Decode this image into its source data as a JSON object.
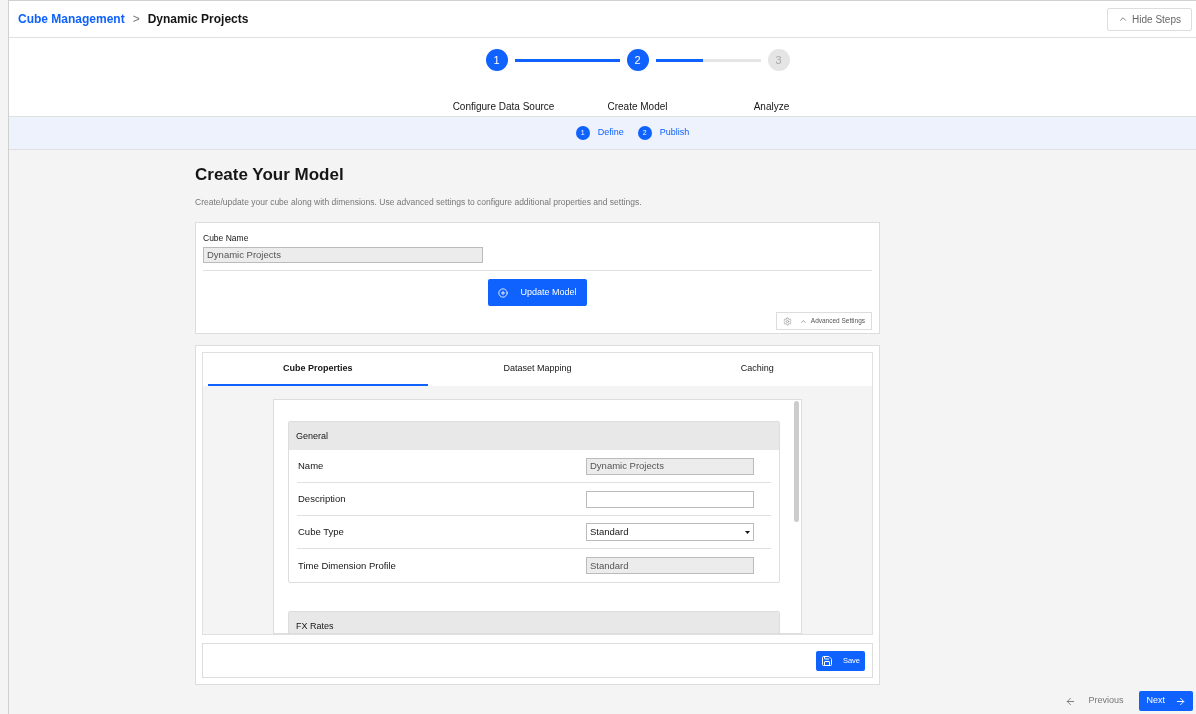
{
  "breadcrumb": {
    "parent": "Cube Management",
    "separator": ">",
    "current": "Dynamic Projects"
  },
  "hide_steps": {
    "label": "Hide Steps"
  },
  "steps": [
    {
      "number": "1",
      "label": "Configure Data Source",
      "reached": true
    },
    {
      "number": "2",
      "label": "Create Model",
      "reached": true
    },
    {
      "number": "3",
      "label": "Analyze",
      "reached": false
    }
  ],
  "connectors": [
    {
      "level": 1
    },
    {
      "level": 0.45
    }
  ],
  "substeps": [
    {
      "number": "1",
      "label": "Define"
    },
    {
      "number": "2",
      "label": "Publish"
    }
  ],
  "page": {
    "title": "Create Your Model",
    "subtitle": "Create/update your cube along with dimensions.  Use advanced settings to configure additional properties and settings."
  },
  "cube_name": {
    "label": "Cube Name",
    "value": "Dynamic Projects",
    "disabled": true
  },
  "update_button": {
    "label": "Update Model"
  },
  "advanced_settings": {
    "label": "Advanced Settings"
  },
  "tabs": [
    {
      "label": "Cube Properties",
      "selected": true
    },
    {
      "label": "Dataset Mapping",
      "selected": false
    },
    {
      "label": "Caching",
      "selected": false
    }
  ],
  "sections": [
    {
      "title": "General",
      "fields": [
        {
          "label": "Name",
          "kind": "text",
          "value": "Dynamic Projects",
          "disabled": true
        },
        {
          "label": "Description",
          "kind": "text",
          "disabled": false
        },
        {
          "label": "Cube Type",
          "kind": "select",
          "value": "Standard",
          "disabled": false
        },
        {
          "label": "Time Dimension Profile",
          "kind": "text",
          "value": "Standard",
          "disabled": true
        }
      ]
    },
    {
      "title": "FX Rates"
    }
  ],
  "save_button": {
    "label": "Save"
  },
  "nav": {
    "previous": "Previous",
    "next": "Next"
  }
}
